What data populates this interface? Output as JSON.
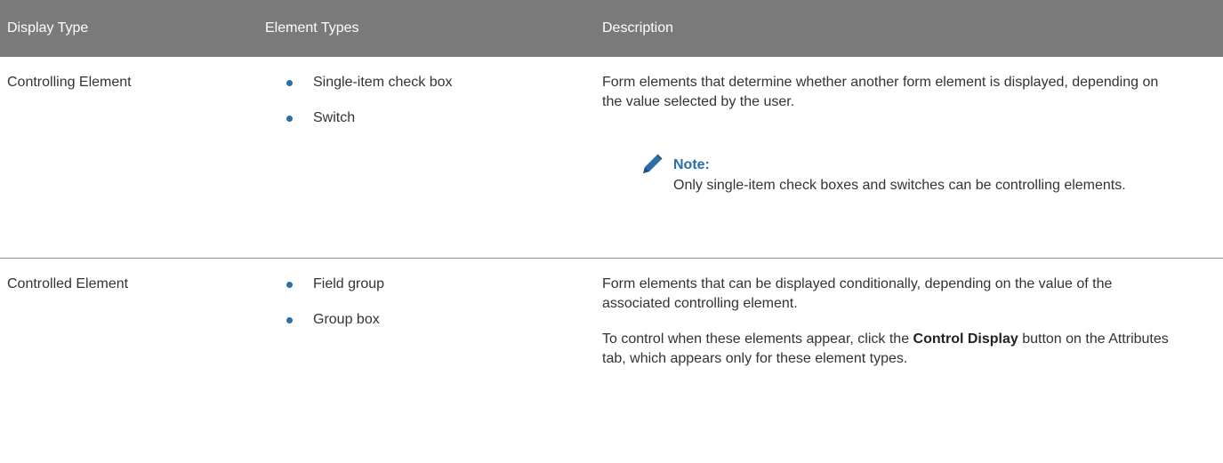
{
  "table": {
    "headers": {
      "display_type": "Display Type",
      "element_types": "Element Types",
      "description": "Description"
    },
    "rows": [
      {
        "display_type": "Controlling Element",
        "element_types": [
          "Single-item check box",
          "Switch"
        ],
        "description": "Form elements that determine whether another form element is displayed, depending on the value selected by the user.",
        "note": {
          "icon": "pencil-icon",
          "title": "Note:",
          "text": "Only single-item check boxes and switches can be controlling elements."
        }
      },
      {
        "display_type": "Controlled Element",
        "element_types": [
          "Field group",
          "Group box"
        ],
        "description": "Form elements that can be displayed conditionally, depending on the value of the associated controlling element.",
        "description2_prefix": "To control when these elements appear, click the ",
        "description2_bold": "Control Display",
        "description2_suffix": " button on the Attributes tab, which appears only for these element types."
      }
    ]
  },
  "colors": {
    "header_bg": "#7a7a7a",
    "accent": "#2b6fa8",
    "text": "#333333"
  }
}
